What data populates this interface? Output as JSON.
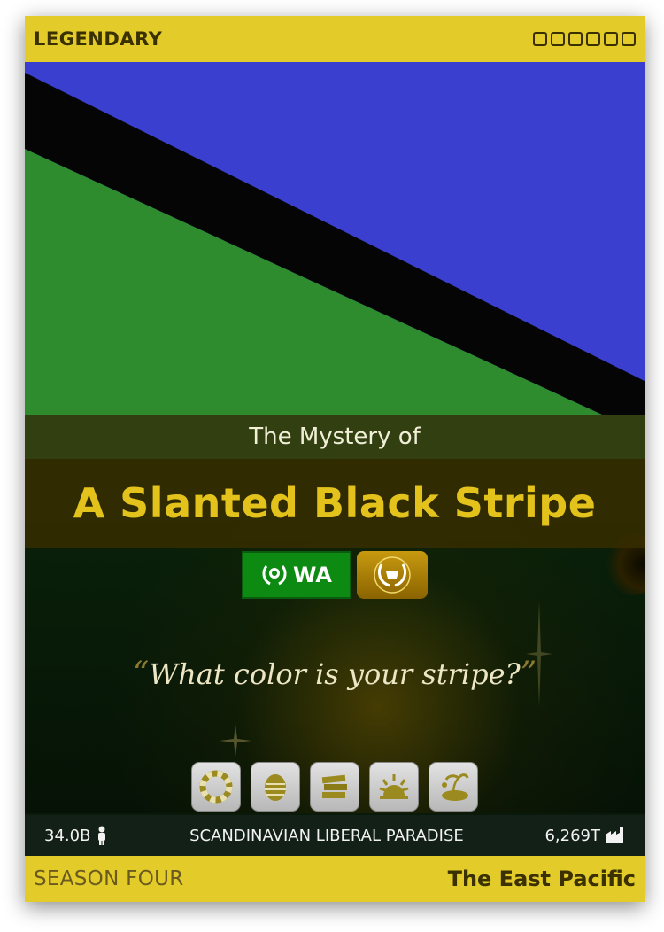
{
  "card": {
    "rarity": "LEGENDARY",
    "pretitle": "The Mystery of",
    "title": "A Slanted Black Stripe",
    "wa_label": "WA",
    "motto": "What color is your stripe?",
    "open_quote": "“",
    "close_quote": "”",
    "population": "34.0B",
    "category": "SCANDINAVIAN LIBERAL PARADISE",
    "economy": "6,269T",
    "season": "SEASON FOUR",
    "region": "The East Pacific"
  },
  "flag": {
    "colors": {
      "blue": "#3a3fd0",
      "black": "#050505",
      "green": "#2e8c2e"
    }
  },
  "colors": {
    "card_bar": "#e3cb2a",
    "title_gold": "#e4c21c",
    "wa_green": "#0c8a12"
  },
  "icons": [
    "top-bar-slot-icon",
    "wa-laurel-icon",
    "gold-laurel-badge-icon",
    "life-preserver-icon",
    "egg-icon",
    "books-icon",
    "sunrise-icon",
    "island-icon",
    "person-icon",
    "factory-icon"
  ]
}
